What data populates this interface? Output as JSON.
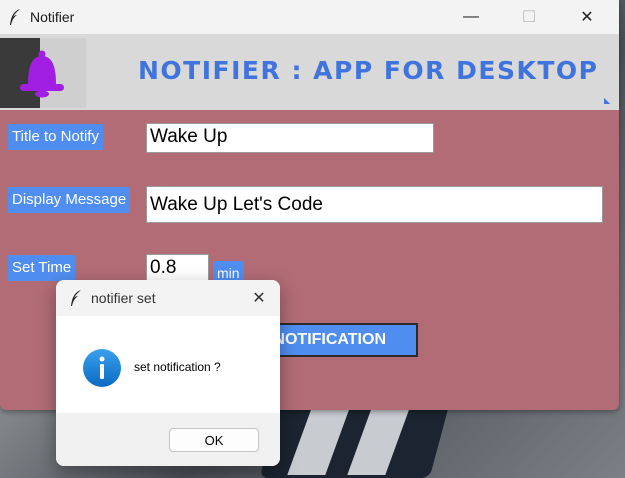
{
  "window": {
    "title": "Notifier",
    "icon": "feather-icon",
    "controls": {
      "minimize": "—",
      "maximize": "☐",
      "close": "✕"
    }
  },
  "banner": {
    "title": "NOTIFIER : APP FOR DESKTOP",
    "icon": "bell-icon",
    "accent_color": "#3f73de",
    "bell_color": "#a11ee3"
  },
  "form": {
    "background_color": "#b26c76",
    "label_color": "#4f8ef0",
    "title_label": "Title to Notify",
    "title_value": "Wake Up",
    "message_label": "Display Message",
    "message_value": "Wake Up Let's Code",
    "time_label": "Set Time",
    "time_value": "0.8",
    "time_unit": "min",
    "submit_label": "NOTIFICATION"
  },
  "dialog": {
    "title": "notifier set",
    "icon": "info-icon",
    "message": "set notification ?",
    "ok_label": "OK"
  }
}
